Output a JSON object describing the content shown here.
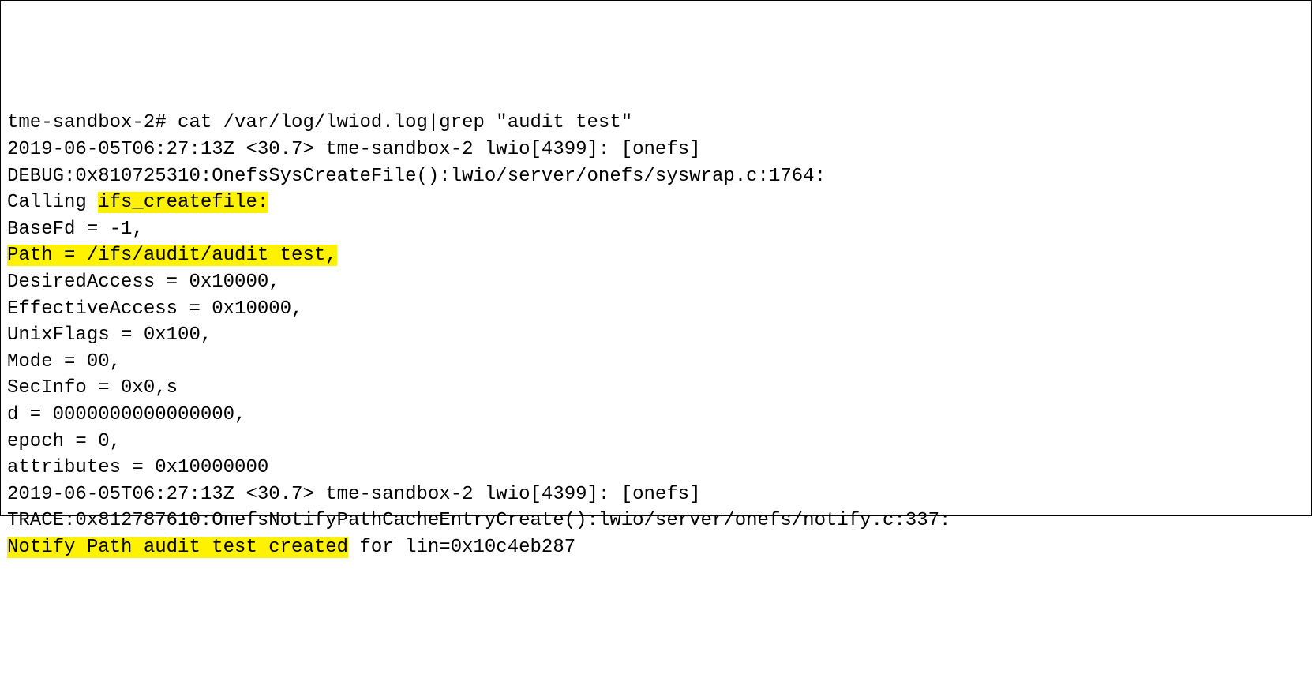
{
  "terminal": {
    "lines": [
      {
        "pre": "tme-sandbox-2# cat /var/log/lwiod.log|grep \"audit test\""
      },
      {
        "pre": "2019-06-05T06:27:13Z <30.7> tme-sandbox-2 lwio[4399]: [onefs] "
      },
      {
        "pre": "DEBUG:0x810725310:OnefsSysCreateFile():lwio/server/onefs/syswrap.c:1764: "
      },
      {
        "pre": "Calling ",
        "hl": "ifs_createfile:",
        "post": " "
      },
      {
        "pre": "BaseFd = -1,"
      },
      {
        "hl": "Path = /ifs/audit/audit test,"
      },
      {
        "pre": "DesiredAccess = 0x10000,"
      },
      {
        "pre": "EffectiveAccess = 0x10000, "
      },
      {
        "pre": "UnixFlags = 0x100,"
      },
      {
        "pre": "Mode = 00,"
      },
      {
        "pre": "SecInfo = 0x0,s"
      },
      {
        "pre": "d = 0000000000000000, "
      },
      {
        "pre": "epoch = 0,"
      },
      {
        "pre": "attributes = 0x10000000"
      },
      {
        "pre": "2019-06-05T06:27:13Z <30.7> tme-sandbox-2 lwio[4399]: [onefs] "
      },
      {
        "pre": "TRACE:0x812787610:OnefsNotifyPathCacheEntryCreate():lwio/server/onefs/notify.c:337: "
      },
      {
        "hl": "Notify Path audit test created",
        "post": " for lin=0x10c4eb287"
      }
    ]
  }
}
